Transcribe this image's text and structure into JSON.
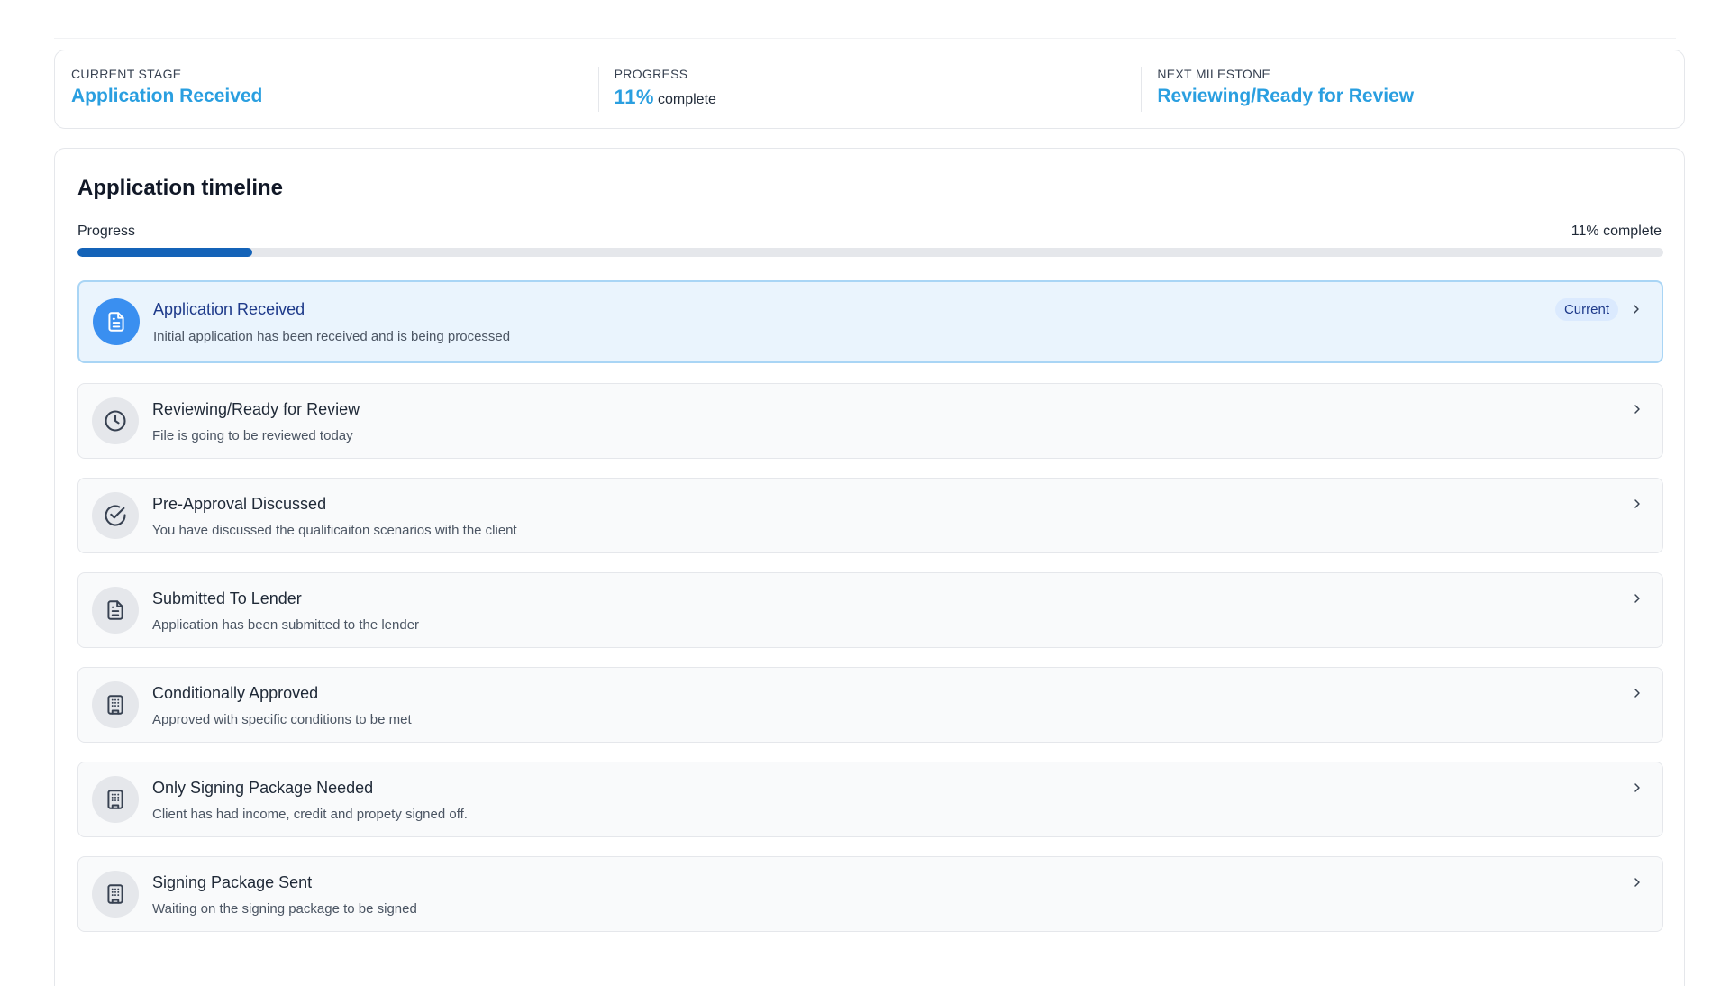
{
  "summary": {
    "current_stage_label": "Current Stage",
    "current_stage_value": "Application Received",
    "progress_label": "Progress",
    "progress_value": "11%",
    "progress_suffix": "complete",
    "next_milestone_label": "Next Milestone",
    "next_milestone_value": "Reviewing/Ready for Review"
  },
  "timeline": {
    "title": "Application timeline",
    "progress_label": "Progress",
    "progress_text": "11% complete",
    "progress_fraction": 0.11,
    "current_badge": "Current",
    "steps": [
      {
        "title": "Application Received",
        "desc": "Initial application has been received and is being processed",
        "icon": "document-icon",
        "current": true
      },
      {
        "title": "Reviewing/Ready for Review",
        "desc": "File is going to be reviewed today",
        "icon": "clock-icon",
        "current": false
      },
      {
        "title": "Pre-Approval Discussed",
        "desc": "You have discussed the qualificaiton scenarios with the client",
        "icon": "check-circle-icon",
        "current": false
      },
      {
        "title": "Submitted To Lender",
        "desc": "Application has been submitted to the lender",
        "icon": "document-icon",
        "current": false
      },
      {
        "title": "Conditionally Approved",
        "desc": "Approved with specific conditions to be met",
        "icon": "building-icon",
        "current": false
      },
      {
        "title": "Only Signing Package Needed",
        "desc": "Client has had income, credit and propety signed off.",
        "icon": "building-icon",
        "current": false
      },
      {
        "title": "Signing Package Sent",
        "desc": "Waiting on the signing package to be signed",
        "icon": "building-icon",
        "current": false
      }
    ]
  },
  "colors": {
    "accent": "#2a9fe0",
    "progress_fill": "#1463b8",
    "current_icon_bg": "#3a8ff0",
    "current_row_bg": "#eaf4fd"
  }
}
